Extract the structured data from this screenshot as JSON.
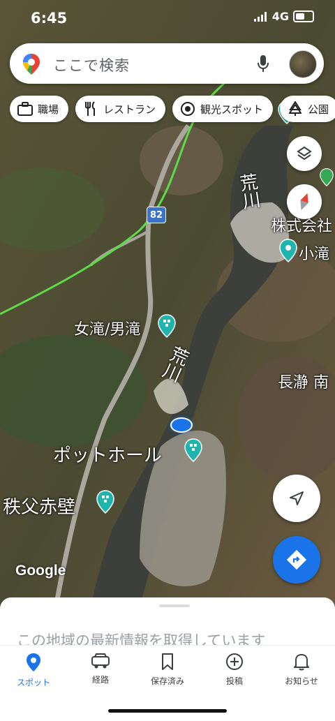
{
  "status_bar": {
    "time": "6:45",
    "network": "4G"
  },
  "search": {
    "placeholder": "ここで検索"
  },
  "chips": [
    {
      "label": "職場",
      "icon": "briefcase-icon"
    },
    {
      "label": "レストラン",
      "icon": "fork-knife-icon"
    },
    {
      "label": "観光スポット",
      "icon": "camera-icon"
    },
    {
      "label": "公園",
      "icon": "tree-icon"
    }
  ],
  "map": {
    "road_number": "82",
    "labels": {
      "river_top": "荒川",
      "river_mid": "荒川",
      "company": "株式会社",
      "kotaki": "小滝",
      "metaki": "女滝/男滝",
      "nagatoro": "長瀞 南",
      "pothole": "ポットホール",
      "chichibu": "秩父赤壁"
    },
    "attribution": "Google",
    "colors": {
      "road_line": "#5ddc4a",
      "poi": "#1fb5ad",
      "accent": "#1a73e8"
    }
  },
  "sheet": {
    "message": "この地域の最新情報を取得しています"
  },
  "nav": [
    {
      "label": "スポット",
      "icon": "location-pin-icon",
      "active": true
    },
    {
      "label": "経路",
      "icon": "car-icon",
      "active": false
    },
    {
      "label": "保存済み",
      "icon": "bookmark-icon",
      "active": false
    },
    {
      "label": "投稿",
      "icon": "plus-circle-icon",
      "active": false
    },
    {
      "label": "お知らせ",
      "icon": "bell-icon",
      "active": false
    }
  ]
}
